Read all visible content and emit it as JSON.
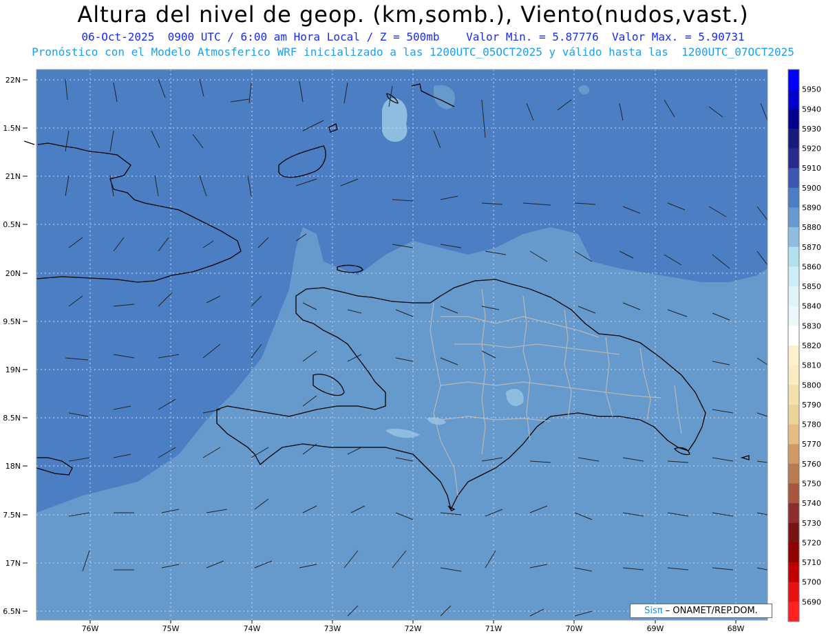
{
  "header": {
    "title": "Altura del nivel de geop. (km,somb.), Viento(nudos,vast.)",
    "line2": "06-Oct-2025  0900 UTC / 6:00 am Hora Local / Z = 500mb    Valor Min. = 5.87776  Valor Max. = 5.90731",
    "line3": "Pronóstico con el Modelo Atmosferico WRF inicializado a las 1200UTC_05OCT2025 y válido hasta las  1200UTC_07OCT2025"
  },
  "axes": {
    "lat_labels": [
      "22N",
      "1.5N",
      "21N",
      "0.5N",
      "20N",
      "9.5N",
      "19N",
      "8.5N",
      "18N",
      "7.5N",
      "17N",
      "6.5N"
    ],
    "lon_labels": [
      "76W",
      "75W",
      "74W",
      "73W",
      "72W",
      "71W",
      "70W",
      "69W",
      "68W"
    ]
  },
  "colorbar": {
    "labels": [
      "5950",
      "5940",
      "5930",
      "5920",
      "5910",
      "5900",
      "5890",
      "5880",
      "5870",
      "5860",
      "5850",
      "5840",
      "5830",
      "5820",
      "5810",
      "5800",
      "5790",
      "5780",
      "5770",
      "5760",
      "5750",
      "5740",
      "5730",
      "5720",
      "5710",
      "5700",
      "5690"
    ],
    "colors": [
      "#0000ff",
      "#0000cc",
      "#00008f",
      "#1a1a7a",
      "#2a2a8c",
      "#3b57b0",
      "#4b7ec2",
      "#6699cc",
      "#8fbde0",
      "#b3dfee",
      "#cdeef6",
      "#e0f4f8",
      "#ecf9fb",
      "#ffffff",
      "#fbf1cc",
      "#f8ecc2",
      "#f3e1ad",
      "#ecd39a",
      "#e3bd82",
      "#cf9a64",
      "#b97c52",
      "#a6573d",
      "#8c2e2e",
      "#7a1414",
      "#8f0000",
      "#c00000",
      "#e81010",
      "#ff2020"
    ]
  },
  "fields": {
    "ocean_color": "#4b7ec2",
    "mid_color": "#6699cc",
    "light_color": "#8fbde0"
  },
  "credit": {
    "sis": "Sisπ",
    "text": "– ONAMET/REP.DOM."
  }
}
